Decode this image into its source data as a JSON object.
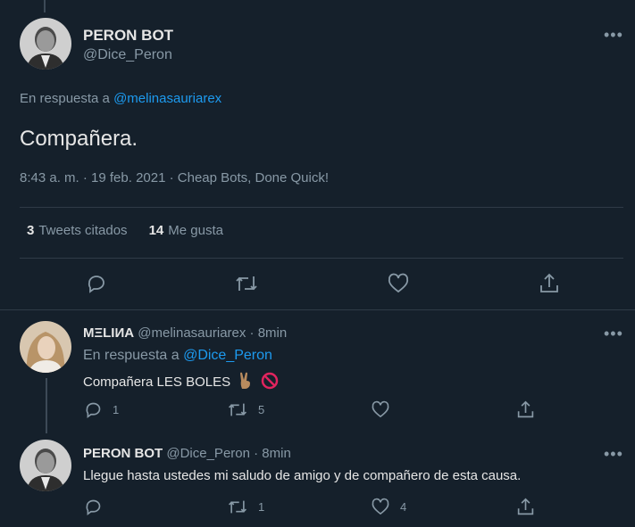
{
  "main_tweet": {
    "name": "PERON BOT",
    "handle": "@Dice_Peron",
    "reply_prefix": "En respuesta a ",
    "reply_to": "@melinasauriarex",
    "text": "Compañera.",
    "meta": "8:43 a. m. · 19 feb. 2021 · Cheap Bots, Done Quick!",
    "quotes_count": "3",
    "quotes_label": "Tweets citados",
    "likes_count": "14",
    "likes_label": "Me gusta",
    "more": "•••"
  },
  "replies": [
    {
      "name": "MΞLIИA",
      "handle": "@melinasauriarex",
      "time": "· 8min",
      "reply_prefix": "En respuesta a ",
      "reply_to": "@Dice_Peron",
      "text": "Compañera LES BOLES",
      "emojis": [
        "victory-hand-emoji",
        "no-entry-emoji"
      ],
      "reply_count": "1",
      "retweet_count": "5",
      "like_count": "",
      "more": "•••"
    },
    {
      "name": "PERON BOT",
      "handle": "@Dice_Peron",
      "time": "· 8min",
      "text": "Llegue hasta ustedes mi saludo de amigo y de compañero de esta causa.",
      "reply_count": "",
      "retweet_count": "1",
      "like_count": "4",
      "more": "•••"
    }
  ],
  "icons": [
    "reply-icon",
    "retweet-icon",
    "like-icon",
    "share-icon"
  ],
  "colors": {
    "background": "#15202b",
    "link": "#1d9bf0",
    "muted": "#8899a6",
    "text": "#e6e6e6"
  }
}
